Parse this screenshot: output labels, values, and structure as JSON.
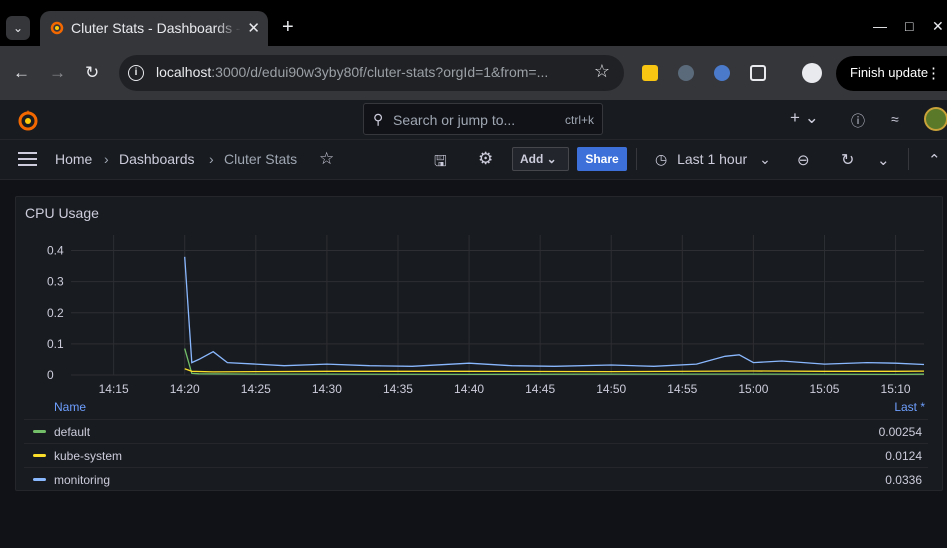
{
  "browser": {
    "tab_title": "Cluter Stats - Dashboards - Grafana",
    "url_host": "localhost",
    "url_rest": ":3000/d/edui90w3yby80f/cluter-stats?orgId=1&from=...",
    "finish_update_label": "Finish update"
  },
  "grafana": {
    "search_placeholder": "Search or jump to...",
    "search_shortcut": "ctrl+k",
    "breadcrumb": [
      "Home",
      "Dashboards",
      "Cluter Stats"
    ],
    "add_label": "Add",
    "share_label": "Share",
    "time_range": "Last 1 hour"
  },
  "panel": {
    "title": "CPU Usage",
    "legend_name_header": "Name",
    "legend_last_header": "Last *",
    "legend": [
      {
        "name": "default",
        "last": "0.00254",
        "color": "#73bf69"
      },
      {
        "name": "kube-system",
        "last": "0.0124",
        "color": "#fade2a"
      },
      {
        "name": "monitoring",
        "last": "0.0336",
        "color": "#8ab8ff"
      }
    ]
  },
  "chart_data": {
    "type": "line",
    "title": "CPU Usage",
    "ylim": [
      0,
      0.45
    ],
    "yticks": [
      "0",
      "0.1",
      "0.2",
      "0.3",
      "0.4"
    ],
    "xticks": [
      "14:15",
      "14:20",
      "14:25",
      "14:30",
      "14:35",
      "14:40",
      "14:45",
      "14:50",
      "14:55",
      "15:00",
      "15:05",
      "15:10"
    ],
    "x_start_minute_of_day": 852,
    "grid": true,
    "legend_position": "bottom",
    "series": [
      {
        "name": "default",
        "color": "#73bf69",
        "x": [
          "14:20",
          "14:20.5",
          "14:21",
          "14:25",
          "14:30",
          "14:40",
          "14:50",
          "15:00",
          "15:10",
          "15:12"
        ],
        "values": [
          0.085,
          0.005,
          0.004,
          0.003,
          0.003,
          0.002,
          0.003,
          0.003,
          0.002,
          0.0025
        ]
      },
      {
        "name": "kube-system",
        "color": "#fade2a",
        "x": [
          "14:20",
          "14:20.5",
          "14:22",
          "14:25",
          "14:30",
          "14:40",
          "14:50",
          "15:00",
          "15:05",
          "15:10",
          "15:12"
        ],
        "values": [
          0.02,
          0.012,
          0.01,
          0.011,
          0.012,
          0.012,
          0.011,
          0.013,
          0.012,
          0.012,
          0.0124
        ]
      },
      {
        "name": "monitoring",
        "color": "#8ab8ff",
        "x": [
          "14:20",
          "14:20.5",
          "14:21",
          "14:22",
          "14:23",
          "14:25",
          "14:27",
          "14:30",
          "14:33",
          "14:36",
          "14:40",
          "14:43",
          "14:46",
          "14:50",
          "14:53",
          "14:56",
          "14:58",
          "14:59",
          "15:00",
          "15:02",
          "15:05",
          "15:08",
          "15:10",
          "15:12"
        ],
        "values": [
          0.38,
          0.04,
          0.05,
          0.075,
          0.04,
          0.035,
          0.03,
          0.035,
          0.03,
          0.028,
          0.038,
          0.03,
          0.028,
          0.032,
          0.028,
          0.035,
          0.06,
          0.065,
          0.04,
          0.045,
          0.035,
          0.04,
          0.038,
          0.0336
        ]
      }
    ]
  }
}
